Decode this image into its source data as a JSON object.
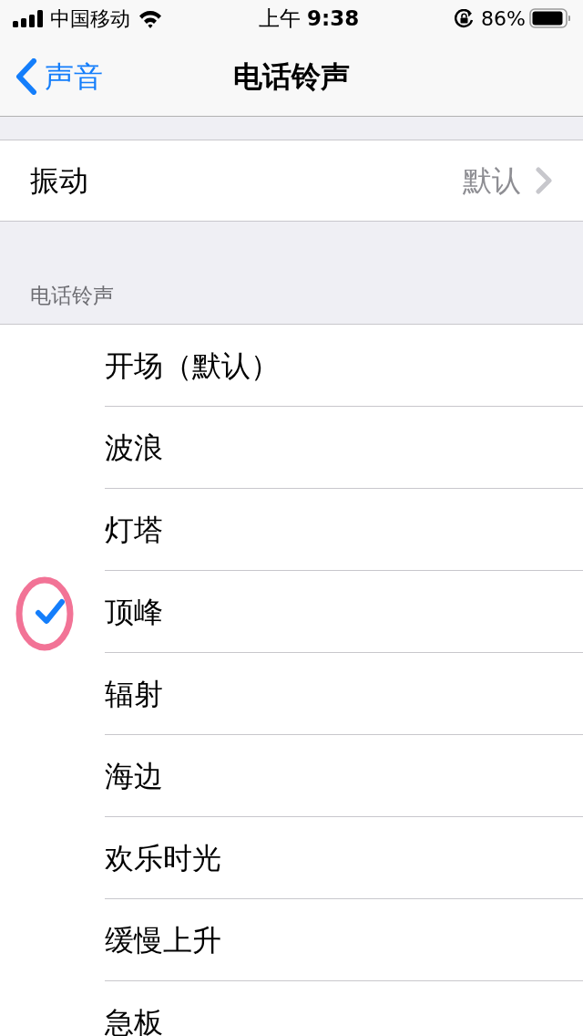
{
  "status_bar": {
    "carrier": "中国移动",
    "time": "上午 **9:38**",
    "battery_percent": "86%"
  },
  "nav_bar": {
    "back": "声音",
    "title": "电话铃声"
  },
  "vibration_row": {
    "label": "振动",
    "value": "默认"
  },
  "section_header": "电话铃声",
  "ringtones": [
    {
      "name": "开场（默认）",
      "selected": false,
      "circled": false
    },
    {
      "name": "波浪",
      "selected": false,
      "circled": false
    },
    {
      "name": "灯塔",
      "selected": false,
      "circled": false
    },
    {
      "name": "顶峰",
      "selected": true,
      "circled": true
    },
    {
      "name": "辐射",
      "selected": false,
      "circled": false
    },
    {
      "name": "海边",
      "selected": false,
      "circled": false
    },
    {
      "name": "欢乐时光",
      "selected": false,
      "circled": false
    },
    {
      "name": "缓慢上升",
      "selected": false,
      "circled": false
    },
    {
      "name": "急板",
      "selected": false,
      "circled": false
    }
  ]
}
